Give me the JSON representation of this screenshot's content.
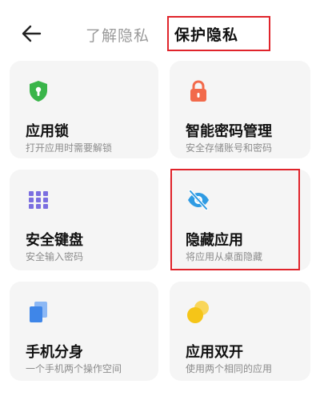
{
  "header": {
    "tabs": [
      {
        "label": "了解隐私",
        "active": false
      },
      {
        "label": "保护隐私",
        "active": true
      }
    ]
  },
  "cards": [
    {
      "title": "应用锁",
      "subtitle": "打开应用时需要解锁",
      "icon": "shield-lock-icon",
      "color": "#3ab54a"
    },
    {
      "title": "智能密码管理",
      "subtitle": "安全存储账号和密码",
      "icon": "padlock-icon",
      "color": "#f26a4b"
    },
    {
      "title": "安全键盘",
      "subtitle": "安全输入密码",
      "icon": "keyboard-grid-icon",
      "color": "#7b6ee0"
    },
    {
      "title": "隐藏应用",
      "subtitle": "将应用从桌面隐藏",
      "icon": "eye-off-icon",
      "color": "#2f9be3"
    },
    {
      "title": "手机分身",
      "subtitle": "一个手机两个操作空间",
      "icon": "dual-pages-icon",
      "color": "#3f86e8"
    },
    {
      "title": "应用双开",
      "subtitle": "使用两个相同的应用",
      "icon": "double-coin-icon",
      "color": "#f5c518"
    }
  ],
  "colors": {
    "highlight": "#e0242b",
    "card_bg": "#f5f5f5"
  }
}
